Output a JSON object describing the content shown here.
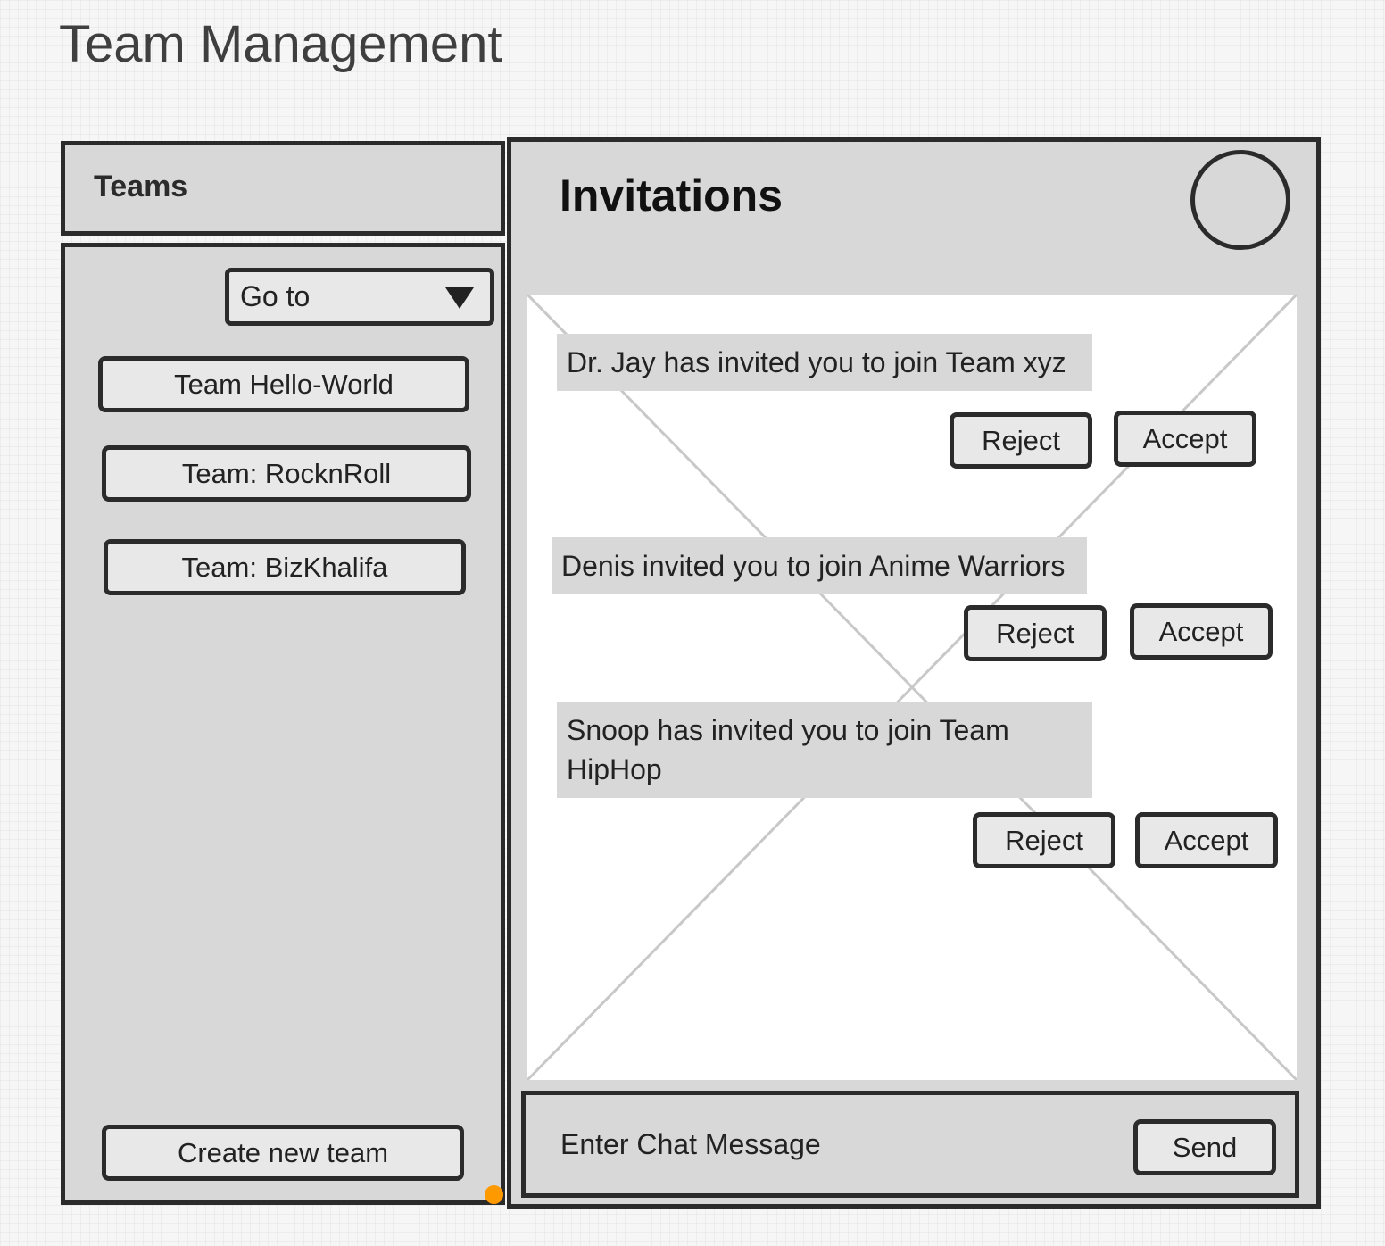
{
  "page": {
    "title": "Team Management"
  },
  "sidebar": {
    "title": "Teams",
    "goto": {
      "label": "Go to"
    },
    "teams": [
      {
        "label": "Team Hello-World"
      },
      {
        "label": "Team: RocknRoll"
      },
      {
        "label": "Team: BizKhalifa"
      }
    ],
    "create_label": "Create new team"
  },
  "invitations": {
    "title": "Invitations",
    "items": [
      {
        "message": "Dr. Jay has invited you to join Team xyz",
        "reject_label": "Reject",
        "accept_label": "Accept"
      },
      {
        "message": "Denis invited you to join Anime Warriors",
        "reject_label": "Reject",
        "accept_label": "Accept"
      },
      {
        "message": "Snoop has invited you to join Team HipHop",
        "reject_label": "Reject",
        "accept_label": "Accept"
      }
    ]
  },
  "chat": {
    "placeholder": "Enter Chat Message",
    "send_label": "Send"
  },
  "colors": {
    "panel": "#d8d8d8",
    "border": "#2b2b2b",
    "button": "#e8e8e8",
    "canvas": "#ffffff",
    "accent_dot": "#ff9900"
  }
}
